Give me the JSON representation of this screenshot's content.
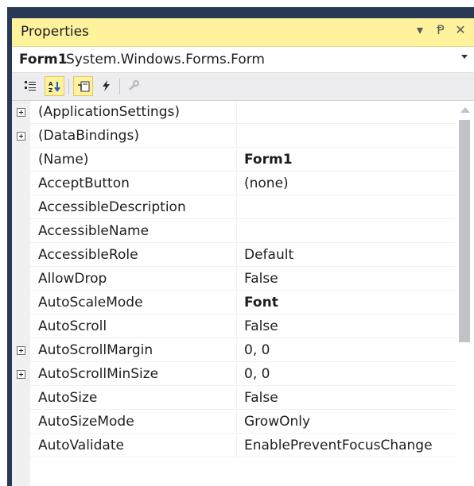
{
  "window": {
    "title": "Properties"
  },
  "title_buttons": [
    {
      "name": "dropdown-arrow-icon",
      "glyph": "▾"
    },
    {
      "name": "pin-icon",
      "glyph": "Ᵽ"
    },
    {
      "name": "close-icon",
      "glyph": "✕"
    }
  ],
  "object": {
    "name": "Form1",
    "type": "System.Windows.Forms.Form"
  },
  "toolbar": {
    "tools": [
      "categorized-icon",
      "alphabetical-icon",
      "properties-icon",
      "events-icon",
      "property-pages-icon"
    ],
    "active": [
      "alphabetical-icon",
      "properties-icon"
    ]
  },
  "properties": [
    {
      "name": "(ApplicationSettings)",
      "value": "",
      "expandable": true,
      "bold": false
    },
    {
      "name": "(DataBindings)",
      "value": "",
      "expandable": true,
      "bold": false
    },
    {
      "name": "(Name)",
      "value": "Form1",
      "expandable": false,
      "bold": true
    },
    {
      "name": "AcceptButton",
      "value": "(none)",
      "expandable": false,
      "bold": false
    },
    {
      "name": "AccessibleDescription",
      "value": "",
      "expandable": false,
      "bold": false
    },
    {
      "name": "AccessibleName",
      "value": "",
      "expandable": false,
      "bold": false
    },
    {
      "name": "AccessibleRole",
      "value": "Default",
      "expandable": false,
      "bold": false
    },
    {
      "name": "AllowDrop",
      "value": "False",
      "expandable": false,
      "bold": false
    },
    {
      "name": "AutoScaleMode",
      "value": "Font",
      "expandable": false,
      "bold": true
    },
    {
      "name": "AutoScroll",
      "value": "False",
      "expandable": false,
      "bold": false
    },
    {
      "name": "AutoScrollMargin",
      "value": "0, 0",
      "expandable": true,
      "bold": false
    },
    {
      "name": "AutoScrollMinSize",
      "value": "0, 0",
      "expandable": true,
      "bold": false
    },
    {
      "name": "AutoSize",
      "value": "False",
      "expandable": false,
      "bold": false
    },
    {
      "name": "AutoSizeMode",
      "value": "GrowOnly",
      "expandable": false,
      "bold": false
    },
    {
      "name": "AutoValidate",
      "value": "EnablePreventFocusChange",
      "expandable": false,
      "bold": false
    }
  ],
  "colors": {
    "frame": "#293955",
    "title_bar": "#fff29d",
    "toolbar": "#ededf0",
    "grid_line": "#f0f0f0",
    "scroll_thumb": "#c2c3c9"
  }
}
